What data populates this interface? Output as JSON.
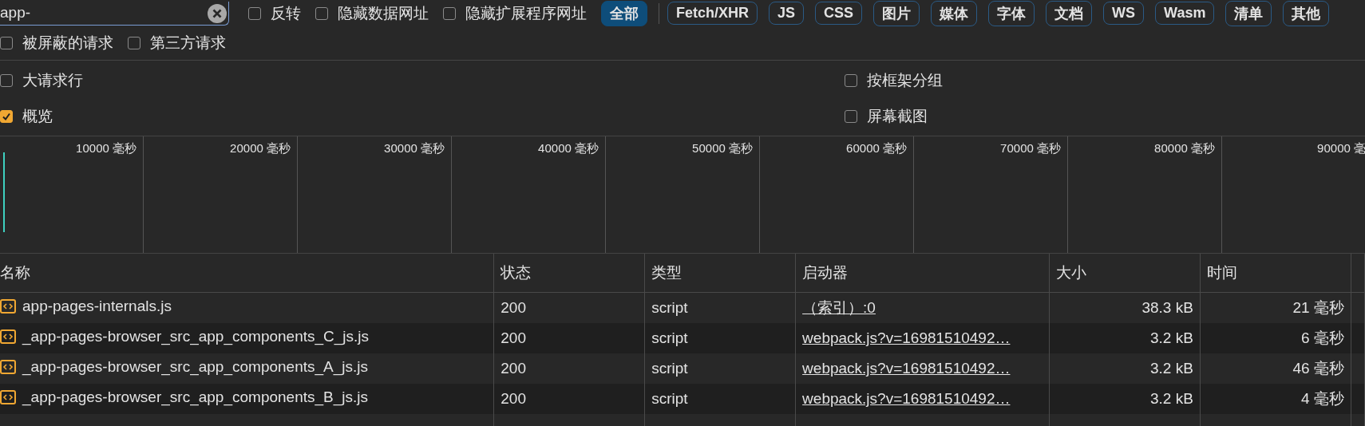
{
  "filter": {
    "value": "app-"
  },
  "filter_options": [
    {
      "label": "反转",
      "checked": false
    },
    {
      "label": "隐藏数据网址",
      "checked": false
    },
    {
      "label": "隐藏扩展程序网址",
      "checked": false
    }
  ],
  "type_filters": [
    {
      "label": "全部",
      "selected": true
    },
    {
      "label": "Fetch/XHR",
      "selected": false
    },
    {
      "label": "JS",
      "selected": false
    },
    {
      "label": "CSS",
      "selected": false
    },
    {
      "label": "图片",
      "selected": false
    },
    {
      "label": "媒体",
      "selected": false
    },
    {
      "label": "字体",
      "selected": false
    },
    {
      "label": "文档",
      "selected": false
    },
    {
      "label": "WS",
      "selected": false
    },
    {
      "label": "Wasm",
      "selected": false
    },
    {
      "label": "清单",
      "selected": false
    },
    {
      "label": "其他",
      "selected": false
    }
  ],
  "request_options": [
    {
      "label": "被屏蔽的请求",
      "checked": false
    },
    {
      "label": "第三方请求",
      "checked": false
    }
  ],
  "settings": {
    "left": [
      {
        "label": "大请求行",
        "checked": false
      },
      {
        "label": "概览",
        "checked": true
      }
    ],
    "right": [
      {
        "label": "按框架分组",
        "checked": false
      },
      {
        "label": "屏幕截图",
        "checked": false
      }
    ]
  },
  "overview": {
    "ticks": [
      "10000 毫秒",
      "20000 毫秒",
      "30000 毫秒",
      "40000 毫秒",
      "50000 毫秒",
      "60000 毫秒",
      "70000 毫秒",
      "80000 毫秒",
      "90000 毫"
    ]
  },
  "table": {
    "columns": [
      "名称",
      "状态",
      "类型",
      "启动器",
      "大小",
      "时间"
    ],
    "rows": [
      {
        "name": "app-pages-internals.js",
        "status": "200",
        "type": "script",
        "initiator": "（索引）:0",
        "size": "38.3 kB",
        "time": "21 毫秒"
      },
      {
        "name": "_app-pages-browser_src_app_components_C_js.js",
        "status": "200",
        "type": "script",
        "initiator": "webpack.js?v=16981510492…",
        "size": "3.2 kB",
        "time": "6 毫秒"
      },
      {
        "name": "_app-pages-browser_src_app_components_A_js.js",
        "status": "200",
        "type": "script",
        "initiator": "webpack.js?v=16981510492…",
        "size": "3.2 kB",
        "time": "46 毫秒"
      },
      {
        "name": "_app-pages-browser_src_app_components_B_js.js",
        "status": "200",
        "type": "script",
        "initiator": "webpack.js?v=16981510492…",
        "size": "3.2 kB",
        "time": "4 毫秒"
      }
    ]
  }
}
